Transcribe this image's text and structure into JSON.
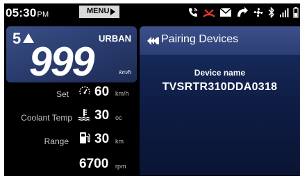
{
  "status_bar": {
    "time": "05:30",
    "ampm": "PM",
    "menu_label": "MENU",
    "icons": [
      "phone-call-icon",
      "missed-call-icon",
      "message-icon",
      "navigation-icon",
      "fan-icon",
      "bluetooth-icon",
      "signal-icon",
      "battery-icon"
    ],
    "missed_call_color": "#e53935"
  },
  "speed_panel": {
    "gear": "5",
    "mode": "URBAN",
    "speed": "999",
    "speed_unit": "km/h"
  },
  "info": {
    "set_label": "Set",
    "set_value": "60",
    "set_unit": "km/h",
    "coolant_label": "Coolant Temp",
    "coolant_value": "30",
    "coolant_unit": "oc",
    "range_label": "Range",
    "range_value": "30",
    "range_unit": "km",
    "rpm_value": "6700",
    "rpm_unit": "rpm"
  },
  "pairing": {
    "title": "Pairing Devices",
    "device_label": "Device name",
    "device_id": "TVSRTR310DDA0318"
  },
  "colors": {
    "panel_blue": "#2c3e74",
    "background": "#000000"
  }
}
